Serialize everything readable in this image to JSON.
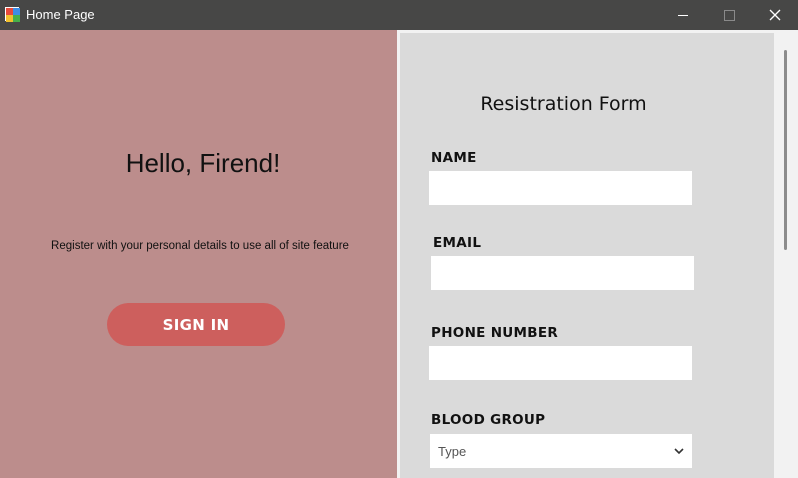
{
  "window": {
    "title": "Home Page",
    "icons": {
      "app": "app-icon",
      "minimize": "minimize-icon",
      "maximize": "maximize-icon",
      "close": "close-icon"
    }
  },
  "left_panel": {
    "background": "#bc8d8c",
    "greeting": "Hello, Firend!",
    "subtitle": "Register with your personal details to use all of site feature",
    "sign_in_label": "SIGN IN",
    "sign_in_color": "#cd5f5d"
  },
  "form": {
    "title": "Resistration Form",
    "fields": {
      "name": {
        "label": "NAME",
        "value": ""
      },
      "email": {
        "label": "EMAIL",
        "value": ""
      },
      "phone": {
        "label": "PHONE NUMBER",
        "value": ""
      },
      "blood_group": {
        "label": "BLOOD GROUP",
        "selected": "Type"
      }
    }
  }
}
